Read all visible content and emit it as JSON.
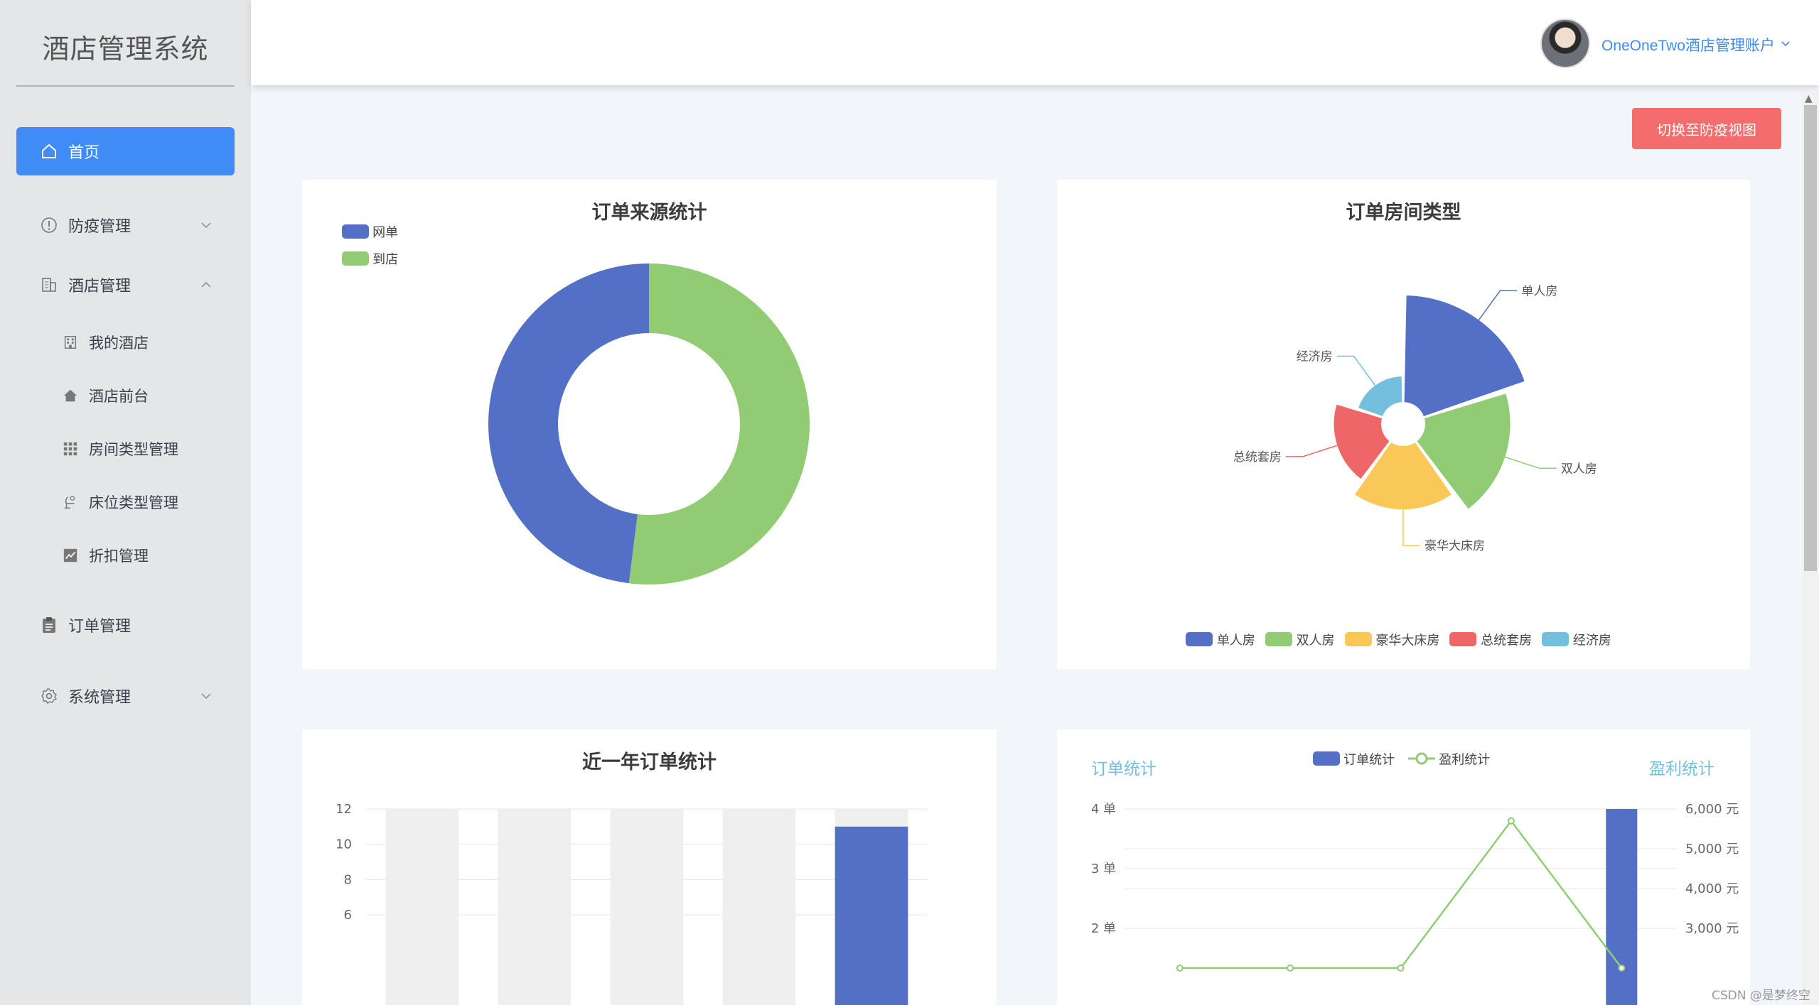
{
  "sidebar": {
    "title": "酒店管理系统",
    "menu": [
      {
        "label": "首页",
        "icon": "home-icon",
        "active": true
      },
      {
        "label": "防疫管理",
        "icon": "alert-circle-icon"
      },
      {
        "label": "酒店管理",
        "icon": "building-icon"
      },
      {
        "label": "订单管理",
        "icon": "clipboard-icon"
      },
      {
        "label": "系统管理",
        "icon": "gear-icon"
      }
    ],
    "submenu": [
      {
        "label": "我的酒店",
        "icon": "office-icon"
      },
      {
        "label": "酒店前台",
        "icon": "house-icon"
      },
      {
        "label": "房间类型管理",
        "icon": "grid-icon"
      },
      {
        "label": "床位类型管理",
        "icon": "lamp-icon"
      },
      {
        "label": "折扣管理",
        "icon": "trend-chart-icon"
      }
    ]
  },
  "header": {
    "account_name": "OneOneTwo酒店管理账户",
    "avatar_icon": "user-avatar"
  },
  "actions": {
    "switch_view_label": "切换至防疫视图"
  },
  "watermark": "CSDN @是梦终空",
  "colors": {
    "primary": "#3f8cf7",
    "danger": "#f46c6c",
    "blue": "#5470c6",
    "green": "#91cc75",
    "yellow": "#fac858",
    "red": "#ee6666",
    "cyan": "#73c0de"
  },
  "chart_data": [
    {
      "type": "pie",
      "variant": "donut",
      "title": "订单来源统计",
      "legend": "top-left",
      "slices": [
        {
          "name": "网单",
          "value": 48,
          "color": "#5470c6"
        },
        {
          "name": "到店",
          "value": 52,
          "color": "#91cc75"
        }
      ]
    },
    {
      "type": "pie",
      "variant": "rose",
      "title": "订单房间类型",
      "legend": "bottom",
      "slices": [
        {
          "name": "单人房",
          "value": 40,
          "color": "#5470c6"
        },
        {
          "name": "双人房",
          "value": 32,
          "color": "#91cc75"
        },
        {
          "name": "豪华大床房",
          "value": 24,
          "color": "#fac858"
        },
        {
          "name": "总统套房",
          "value": 18,
          "color": "#ee6666"
        },
        {
          "name": "经济房",
          "value": 10,
          "color": "#73c0de"
        }
      ]
    },
    {
      "type": "bar",
      "title": "近一年订单统计",
      "yticks": [
        "12",
        "10",
        "8",
        "6"
      ],
      "ylim": [
        0,
        12
      ],
      "background_bars": true,
      "values": [
        0,
        0,
        0,
        0,
        11
      ],
      "color": "#5470c6"
    },
    {
      "type": "bar-line",
      "legend": "top",
      "left_axis_label": "订单统计",
      "right_axis_label": "盈利统计",
      "series": [
        {
          "name": "订单统计",
          "type": "bar",
          "color": "#5470c6"
        },
        {
          "name": "盈利统计",
          "type": "line",
          "color": "#91cc75"
        }
      ],
      "left_ticks": [
        "4 单",
        "3 单",
        "2 单"
      ],
      "right_ticks": [
        "6,000 元",
        "5,000 元",
        "4,000 元",
        "3,000 元"
      ],
      "bar_values": [
        0,
        0,
        0,
        0,
        4
      ],
      "line_values": [
        2000,
        2000,
        2000,
        5700,
        2000
      ],
      "left_ylim": [
        0,
        4
      ],
      "right_ylim": [
        0,
        6000
      ]
    }
  ]
}
